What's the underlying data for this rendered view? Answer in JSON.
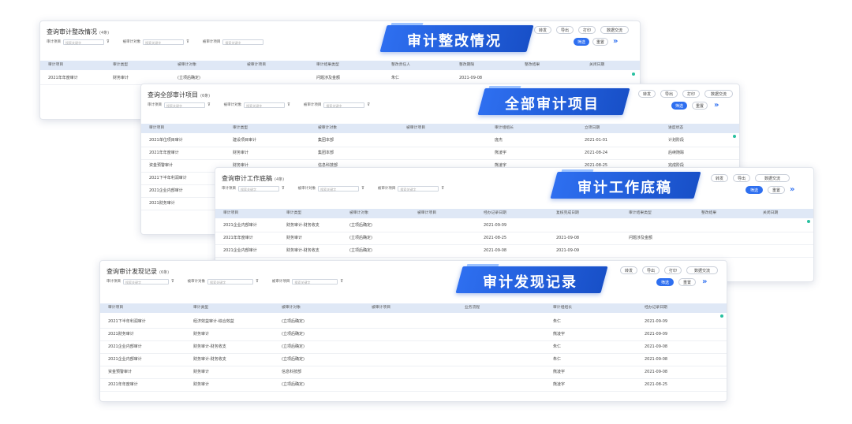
{
  "common": {
    "filter_icon": "filter-icon",
    "filter_placeholder": "搜索关键字"
  },
  "cards": [
    {
      "title": "查询审计整改情况",
      "count": "(4条)",
      "banner": "审计整改情况",
      "filters": [
        "审计项目",
        "被审计对象",
        "被审计项目"
      ],
      "buttons": [
        "转发",
        "导出",
        "打印",
        "数据交流"
      ],
      "filter_btn": "筛选",
      "reset_btn": "重置",
      "headers": [
        "审计项目",
        "审计类型",
        "被审计对象",
        "被审计项目",
        "审计结果类型",
        "整改责任人",
        "整改期限",
        "整改结果",
        "关闭日期"
      ],
      "rows": [
        [
          "2021年年度审计",
          "财务审计",
          "(立项后确定)",
          "",
          "问题涉及金额",
          "朱仁",
          "2021-09-08",
          "",
          ""
        ]
      ]
    },
    {
      "title": "查询全部审计项目",
      "count": "(6条)",
      "banner": "全部审计项目",
      "filters": [
        "审计项目",
        "被审计对象",
        "被审计项目"
      ],
      "buttons": [
        "转发",
        "导出",
        "打印",
        "数据交流"
      ],
      "filter_btn": "筛选",
      "reset_btn": "重置",
      "headers": [
        "审计项目",
        "审计类型",
        "被审计对象",
        "被审计项目",
        "审计组组长",
        "立项日期",
        "进度状态"
      ],
      "rows": [
        [
          "2021单位项目审计",
          "建设项目审计",
          "集团本部",
          "",
          "庞杰",
          "2021-01-01",
          "计划阶段"
        ],
        [
          "2021年年度审计",
          "财务审计",
          "集团本部",
          "",
          "熊凌宇",
          "2021-08-24",
          "后续随踪"
        ],
        [
          "资金预警审计",
          "财务审计",
          "信息科技部",
          "",
          "熊凌宇",
          "2021-08-25",
          "完成阶段"
        ],
        [
          "2021下半年利润审计",
          "",
          "",
          "",
          "",
          "",
          ""
        ],
        [
          "2021企业内部审计",
          "",
          "",
          "",
          "",
          "",
          ""
        ],
        [
          "2021财务审计",
          "",
          "",
          "",
          "",
          "",
          ""
        ]
      ]
    },
    {
      "title": "查询审计工作底稿",
      "count": "(4条)",
      "banner": "审计工作底稿",
      "filters": [
        "审计项目",
        "被审计对象",
        "被审计项目"
      ],
      "buttons": [
        "转发",
        "导出",
        "数据交流"
      ],
      "filter_btn": "筛选",
      "reset_btn": "重置",
      "headers": [
        "审计项目",
        "审计类型",
        "被审计对象",
        "被审计项目",
        "经办记录日期",
        "复核完成日期",
        "审计结果类型",
        "整改结果",
        "关闭日期"
      ],
      "rows": [
        [
          "2021企业内部审计",
          "财务审计-财务收支",
          "(立项后确定)",
          "",
          "2021-09-09",
          "",
          "",
          "",
          ""
        ],
        [
          "2021年年度审计",
          "财务审计",
          "(立项后确定)",
          "",
          "2021-08-25",
          "2021-09-08",
          "问题涉及金额",
          "",
          ""
        ],
        [
          "2021企业内部审计",
          "财务审计-财务收支",
          "(立项后确定)",
          "",
          "2021-09-08",
          "2021-09-09",
          "",
          "",
          ""
        ]
      ]
    },
    {
      "title": "查询审计发现记录",
      "count": "(6条)",
      "banner": "审计发现记录",
      "filters": [
        "审计项目",
        "被审计对象",
        "被审计项目"
      ],
      "buttons": [
        "转发",
        "导出",
        "打印",
        "数据交流"
      ],
      "filter_btn": "筛选",
      "reset_btn": "重置",
      "headers": [
        "审计项目",
        "审计类型",
        "被审计对象",
        "被审计项目",
        "业务流程",
        "审计组组长",
        "经办记录日期"
      ],
      "rows": [
        [
          "2021下半年利润审计",
          "经济效益审计-综合效益",
          "(立项后确定)",
          "",
          "",
          "朱仁",
          "2021-09-09"
        ],
        [
          "2021财务审计",
          "财务审计",
          "(立项后确定)",
          "",
          "",
          "熊凌宇",
          "2021-09-09"
        ],
        [
          "2021企业内部审计",
          "财务审计-财务收支",
          "(立项后确定)",
          "",
          "",
          "朱仁",
          "2021-09-08"
        ],
        [
          "2021企业内部审计",
          "财务审计-财务收支",
          "(立项后确定)",
          "",
          "",
          "朱仁",
          "2021-09-08"
        ],
        [
          "资金预警审计",
          "财务审计",
          "信息科技部",
          "",
          "",
          "熊凌宇",
          "2021-09-08"
        ],
        [
          "2021年年度审计",
          "财务审计",
          "(立项后确定)",
          "",
          "",
          "熊凌宇",
          "2021-08-25"
        ]
      ]
    }
  ]
}
